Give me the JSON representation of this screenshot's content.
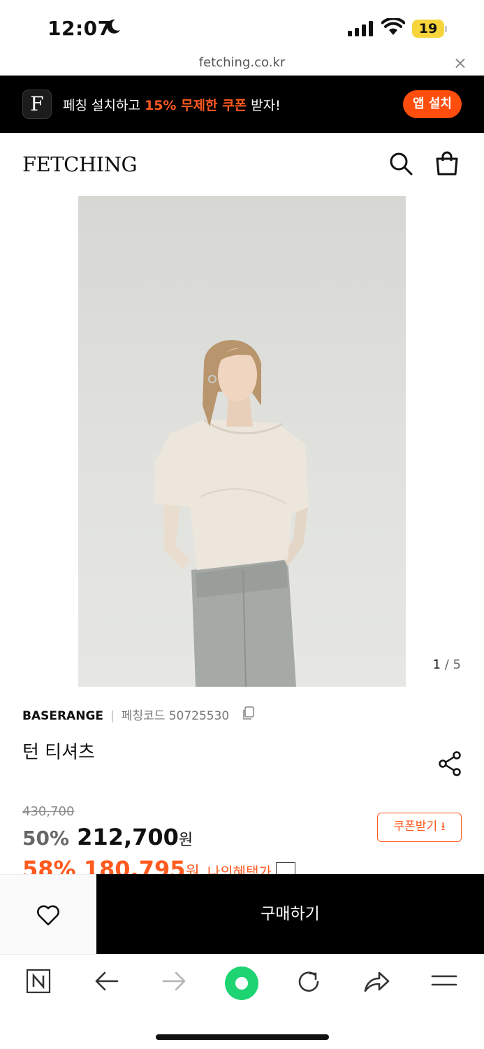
{
  "status_bar": {
    "time": "12:07",
    "battery_level": "19",
    "battery_color": "#f7d43a"
  },
  "browser": {
    "url": "fetching.co.kr",
    "close_symbol": "×"
  },
  "promo_banner": {
    "app_letter": "F",
    "text_before": "페칭 설치하고 ",
    "text_highlight": "15% 무제한 쿠폰",
    "text_after": " 받자!",
    "install_label": "앱 설치",
    "accent_color": "#ff4d0d"
  },
  "header": {
    "logo": "FETCHING",
    "icons": [
      "search-icon",
      "shopping-bag-icon"
    ]
  },
  "gallery": {
    "current": "1",
    "separator": " / ",
    "total": "5"
  },
  "product": {
    "brand": "BASERANGE",
    "code_label": "페칭코드 50725530",
    "name": "턴 티셔츠",
    "original_price": "430,700",
    "discount_rate": "50%",
    "sale_price": "212,700",
    "currency": "원",
    "coupon_label": "쿠폰받기 ⭳",
    "benefit_rate": "58%",
    "benefit_price": "180,795",
    "benefit_label": "나의혜택가"
  },
  "actions": {
    "buy_label": "구매하기",
    "wish_icon": "heart-icon"
  },
  "toolbar": {
    "items": [
      "naver-home-icon",
      "back-arrow-icon",
      "forward-arrow-icon",
      "green-dot-button-icon",
      "reload-icon",
      "share-icon",
      "menu-icon"
    ]
  }
}
